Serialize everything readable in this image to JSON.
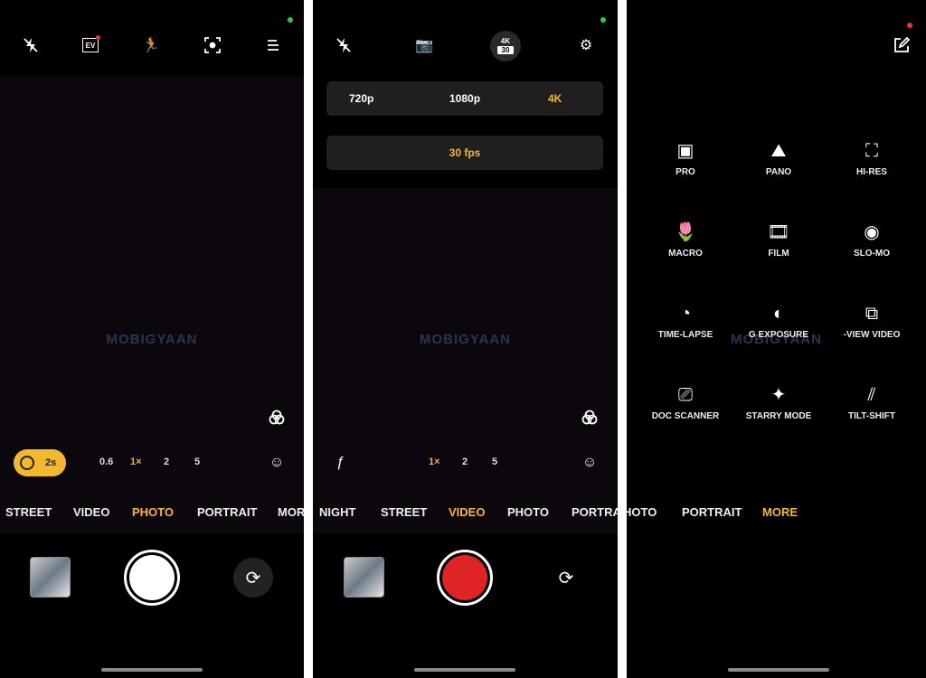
{
  "accent_color": "#f3b82e",
  "record_color": "#e02424",
  "watermark": "MOBIGYAAN",
  "panel_photo": {
    "top_icons": [
      "flash-off-icon",
      "ev-icon",
      "motion-icon",
      "focus-icon",
      "menu-icon"
    ],
    "ev_label": "EV",
    "timer_label": "2s",
    "zoom_levels": [
      "0.6",
      "1×",
      "2",
      "5"
    ],
    "active_zoom": "1×",
    "modes": [
      "STREET",
      "VIDEO",
      "PHOTO",
      "PORTRAIT",
      "MOR"
    ],
    "active_mode": "PHOTO"
  },
  "panel_video": {
    "top_icons": [
      "flash-off-icon",
      "camera-mode-icon",
      "resolution-badge-icon",
      "settings-icon"
    ],
    "badge_top": "4K",
    "badge_bottom": "30",
    "resolutions": [
      "720p",
      "1080p",
      "4K"
    ],
    "active_resolution": "4K",
    "fps": "30 fps",
    "filter_label": "ƒ",
    "zoom_levels": [
      "1×",
      "2",
      "5"
    ],
    "active_zoom": "1×",
    "modes": [
      "NIGHT",
      "STREET",
      "VIDEO",
      "PHOTO",
      "PORTRA"
    ],
    "active_mode": "VIDEO"
  },
  "panel_more": {
    "items": [
      {
        "label": "PRO",
        "icon": "pro-icon"
      },
      {
        "label": "PANO",
        "icon": "pano-icon"
      },
      {
        "label": "HI-RES",
        "icon": "hi-res-icon"
      },
      {
        "label": "MACRO",
        "icon": "macro-icon"
      },
      {
        "label": "FILM",
        "icon": "film-icon"
      },
      {
        "label": "SLO-MO",
        "icon": "slo-mo-icon"
      },
      {
        "label": "TIME-LAPSE",
        "icon": "time-lapse-icon"
      },
      {
        "label": "G EXPOSURE",
        "icon": "exposure-icon"
      },
      {
        "label": "-VIEW VIDEO",
        "icon": "dual-view-video-icon"
      },
      {
        "label": "DOC SCANNER",
        "icon": "doc-scanner-icon"
      },
      {
        "label": "STARRY MODE",
        "icon": "starry-icon"
      },
      {
        "label": "TILT-SHIFT",
        "icon": "tilt-shift-icon"
      }
    ],
    "modes": [
      "HOTO",
      "PORTRAIT",
      "MORE"
    ],
    "active_mode": "MORE"
  }
}
